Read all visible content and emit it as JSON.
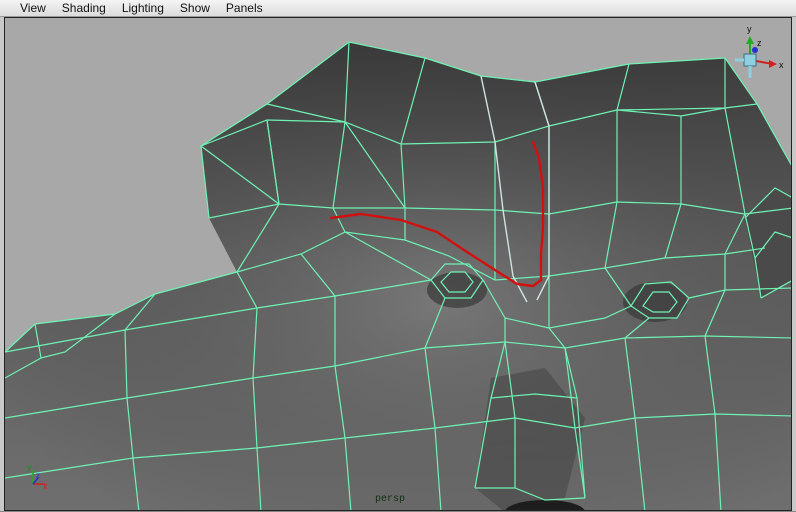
{
  "menubar": {
    "items": [
      "View",
      "Shading",
      "Lighting",
      "Show",
      "Panels"
    ]
  },
  "viewport": {
    "camera_label": "persp",
    "wire_color": "#6ff2b4",
    "stroke_color": "#d21010",
    "background_color": "#a8a8a8"
  },
  "view_cube": {
    "axes": {
      "y": "y",
      "z": "z",
      "x": "x"
    }
  },
  "origin_axis": {
    "axes": {
      "y": "y",
      "z": "z",
      "x": "x"
    }
  }
}
